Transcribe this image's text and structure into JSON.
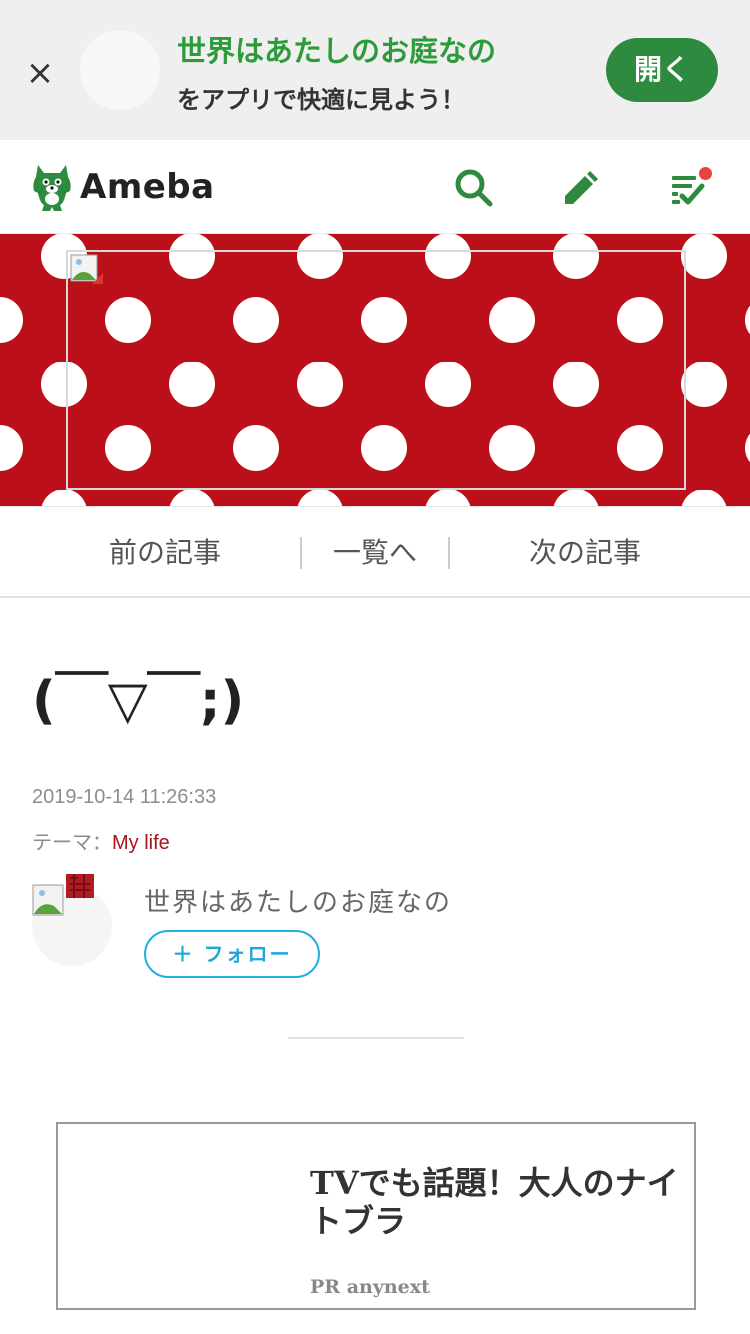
{
  "app_banner": {
    "close_glyph": "×",
    "title": "世界はあたしのお庭なの",
    "subtitle": "をアプリで快適に見よう！",
    "open_label": "開く",
    "accent": "#2d8a3e"
  },
  "header": {
    "logo_text": "Ameba",
    "icons": [
      "search-icon",
      "edit-icon",
      "feed-icon"
    ],
    "notification_dot_color": "#e8453c"
  },
  "hero": {
    "background": "#bb0f1a",
    "pattern": "white-polka-dots"
  },
  "article_nav": {
    "prev_label": "前の記事",
    "list_label": "一覧へ",
    "next_label": "次の記事"
  },
  "entry": {
    "title": "(￣▽￣;)",
    "date": "2019-10-14 11:26:33",
    "theme_label": "テーマ：",
    "theme_value": "My life",
    "theme_color": "#a8141c"
  },
  "author": {
    "name": "世界はあたしのお庭なの",
    "follow_label": "＋ フォロー",
    "follow_color": "#20b1e3"
  },
  "ad": {
    "title": "TVでも話題！大人のナイトブラ",
    "sponsor": "PR anynext"
  }
}
